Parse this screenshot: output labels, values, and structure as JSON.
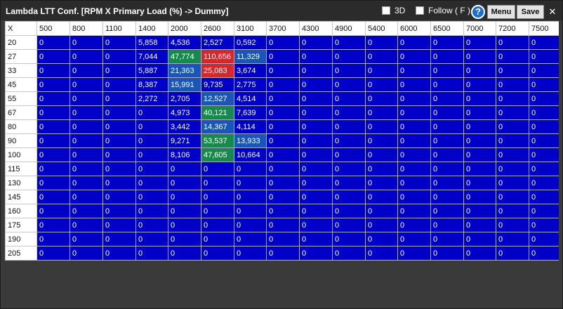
{
  "window": {
    "title": "Lambda LTT Conf. [RPM X Primary Load (%) -> Dummy]",
    "options": {
      "three_d_label": "3D",
      "three_d_checked": false,
      "follow_label": "Follow ( F )",
      "follow_checked": false
    },
    "help_label": "?",
    "menu_label": "Menu",
    "save_label": "Save",
    "close_label": "✕"
  },
  "colors": {
    "cell_blue": "#0000c8",
    "high_red": "#d8262a",
    "mid_green": "#158a4c",
    "low_blue": "#1a56b8",
    "title_bg": "#2b2b2b"
  },
  "table": {
    "corner_label": "X",
    "columns": [
      "500",
      "800",
      "1100",
      "1400",
      "2000",
      "2600",
      "3100",
      "3700",
      "4300",
      "4900",
      "5400",
      "6000",
      "6500",
      "7000",
      "7200",
      "7500"
    ],
    "rows": [
      {
        "label": "20",
        "values": [
          "0",
          "0",
          "0",
          "5,858",
          "4,536",
          "2,527",
          "0,592",
          "0",
          "0",
          "0",
          "0",
          "0",
          "0",
          "0",
          "0",
          "0"
        ],
        "hl": [
          "",
          "",
          "",
          "",
          "",
          "",
          "",
          "",
          "",
          "",
          "",
          "",
          "",
          "",
          "",
          ""
        ]
      },
      {
        "label": "27",
        "values": [
          "0",
          "0",
          "0",
          "7,044",
          "47,774",
          "110,656",
          "11,329",
          "0",
          "0",
          "0",
          "0",
          "0",
          "0",
          "0",
          "0",
          "0"
        ],
        "hl": [
          "",
          "",
          "",
          "",
          "g",
          "r",
          "b",
          "",
          "",
          "",
          "",
          "",
          "",
          "",
          "",
          ""
        ]
      },
      {
        "label": "33",
        "values": [
          "0",
          "0",
          "0",
          "5,887",
          "21,363",
          "25,083",
          "3,674",
          "0",
          "0",
          "0",
          "0",
          "0",
          "0",
          "0",
          "0",
          "0"
        ],
        "hl": [
          "",
          "",
          "",
          "",
          "b",
          "r",
          "",
          "",
          "",
          "",
          "",
          "",
          "",
          "",
          "",
          ""
        ]
      },
      {
        "label": "45",
        "values": [
          "0",
          "0",
          "0",
          "8,387",
          "15,991",
          "9,735",
          "2,775",
          "0",
          "0",
          "0",
          "0",
          "0",
          "0",
          "0",
          "0",
          "0"
        ],
        "hl": [
          "",
          "",
          "",
          "",
          "b",
          "",
          "",
          "",
          "",
          "",
          "",
          "",
          "",
          "",
          "",
          ""
        ]
      },
      {
        "label": "55",
        "values": [
          "0",
          "0",
          "0",
          "2,272",
          "2,705",
          "12,527",
          "4,514",
          "0",
          "0",
          "0",
          "0",
          "0",
          "0",
          "0",
          "0",
          "0"
        ],
        "hl": [
          "",
          "",
          "",
          "",
          "",
          "b",
          "",
          "",
          "",
          "",
          "",
          "",
          "",
          "",
          "",
          ""
        ]
      },
      {
        "label": "67",
        "values": [
          "0",
          "0",
          "0",
          "0",
          "4,973",
          "40,121",
          "7,639",
          "0",
          "0",
          "0",
          "0",
          "0",
          "0",
          "0",
          "0",
          "0"
        ],
        "hl": [
          "",
          "",
          "",
          "",
          "",
          "g",
          "",
          "",
          "",
          "",
          "",
          "",
          "",
          "",
          "",
          ""
        ]
      },
      {
        "label": "80",
        "values": [
          "0",
          "0",
          "0",
          "0",
          "3,442",
          "14,367",
          "4,114",
          "0",
          "0",
          "0",
          "0",
          "0",
          "0",
          "0",
          "0",
          "0"
        ],
        "hl": [
          "",
          "",
          "",
          "",
          "",
          "b",
          "",
          "",
          "",
          "",
          "",
          "",
          "",
          "",
          "",
          ""
        ]
      },
      {
        "label": "90",
        "values": [
          "0",
          "0",
          "0",
          "0",
          "9,271",
          "53,537",
          "13,933",
          "0",
          "0",
          "0",
          "0",
          "0",
          "0",
          "0",
          "0",
          "0"
        ],
        "hl": [
          "",
          "",
          "",
          "",
          "",
          "g",
          "b",
          "",
          "",
          "",
          "",
          "",
          "",
          "",
          "",
          ""
        ]
      },
      {
        "label": "100",
        "values": [
          "0",
          "0",
          "0",
          "0",
          "8,106",
          "47,605",
          "10,664",
          "0",
          "0",
          "0",
          "0",
          "0",
          "0",
          "0",
          "0",
          "0"
        ],
        "hl": [
          "",
          "",
          "",
          "",
          "",
          "g",
          "",
          "",
          "",
          "",
          "",
          "",
          "",
          "",
          "",
          ""
        ]
      },
      {
        "label": "115",
        "values": [
          "0",
          "0",
          "0",
          "0",
          "0",
          "0",
          "0",
          "0",
          "0",
          "0",
          "0",
          "0",
          "0",
          "0",
          "0",
          "0"
        ],
        "hl": [
          "",
          "",
          "",
          "",
          "",
          "",
          "",
          "",
          "",
          "",
          "",
          "",
          "",
          "",
          "",
          ""
        ]
      },
      {
        "label": "130",
        "values": [
          "0",
          "0",
          "0",
          "0",
          "0",
          "0",
          "0",
          "0",
          "0",
          "0",
          "0",
          "0",
          "0",
          "0",
          "0",
          "0"
        ],
        "hl": [
          "",
          "",
          "",
          "",
          "",
          "",
          "",
          "",
          "",
          "",
          "",
          "",
          "",
          "",
          "",
          ""
        ]
      },
      {
        "label": "145",
        "values": [
          "0",
          "0",
          "0",
          "0",
          "0",
          "0",
          "0",
          "0",
          "0",
          "0",
          "0",
          "0",
          "0",
          "0",
          "0",
          "0"
        ],
        "hl": [
          "",
          "",
          "",
          "",
          "",
          "",
          "",
          "",
          "",
          "",
          "",
          "",
          "",
          "",
          "",
          ""
        ]
      },
      {
        "label": "160",
        "values": [
          "0",
          "0",
          "0",
          "0",
          "0",
          "0",
          "0",
          "0",
          "0",
          "0",
          "0",
          "0",
          "0",
          "0",
          "0",
          "0"
        ],
        "hl": [
          "",
          "",
          "",
          "",
          "",
          "",
          "",
          "",
          "",
          "",
          "",
          "",
          "",
          "",
          "",
          ""
        ]
      },
      {
        "label": "175",
        "values": [
          "0",
          "0",
          "0",
          "0",
          "0",
          "0",
          "0",
          "0",
          "0",
          "0",
          "0",
          "0",
          "0",
          "0",
          "0",
          "0"
        ],
        "hl": [
          "",
          "",
          "",
          "",
          "",
          "",
          "",
          "",
          "",
          "",
          "",
          "",
          "",
          "",
          "",
          ""
        ]
      },
      {
        "label": "190",
        "values": [
          "0",
          "0",
          "0",
          "0",
          "0",
          "0",
          "0",
          "0",
          "0",
          "0",
          "0",
          "0",
          "0",
          "0",
          "0",
          "0"
        ],
        "hl": [
          "",
          "",
          "",
          "",
          "",
          "",
          "",
          "",
          "",
          "",
          "",
          "",
          "",
          "",
          "",
          ""
        ]
      },
      {
        "label": "205",
        "values": [
          "0",
          "0",
          "0",
          "0",
          "0",
          "0",
          "0",
          "0",
          "0",
          "0",
          "0",
          "0",
          "0",
          "0",
          "0",
          "0"
        ],
        "hl": [
          "",
          "",
          "",
          "",
          "",
          "",
          "",
          "",
          "",
          "",
          "",
          "",
          "",
          "",
          "",
          ""
        ]
      }
    ]
  }
}
